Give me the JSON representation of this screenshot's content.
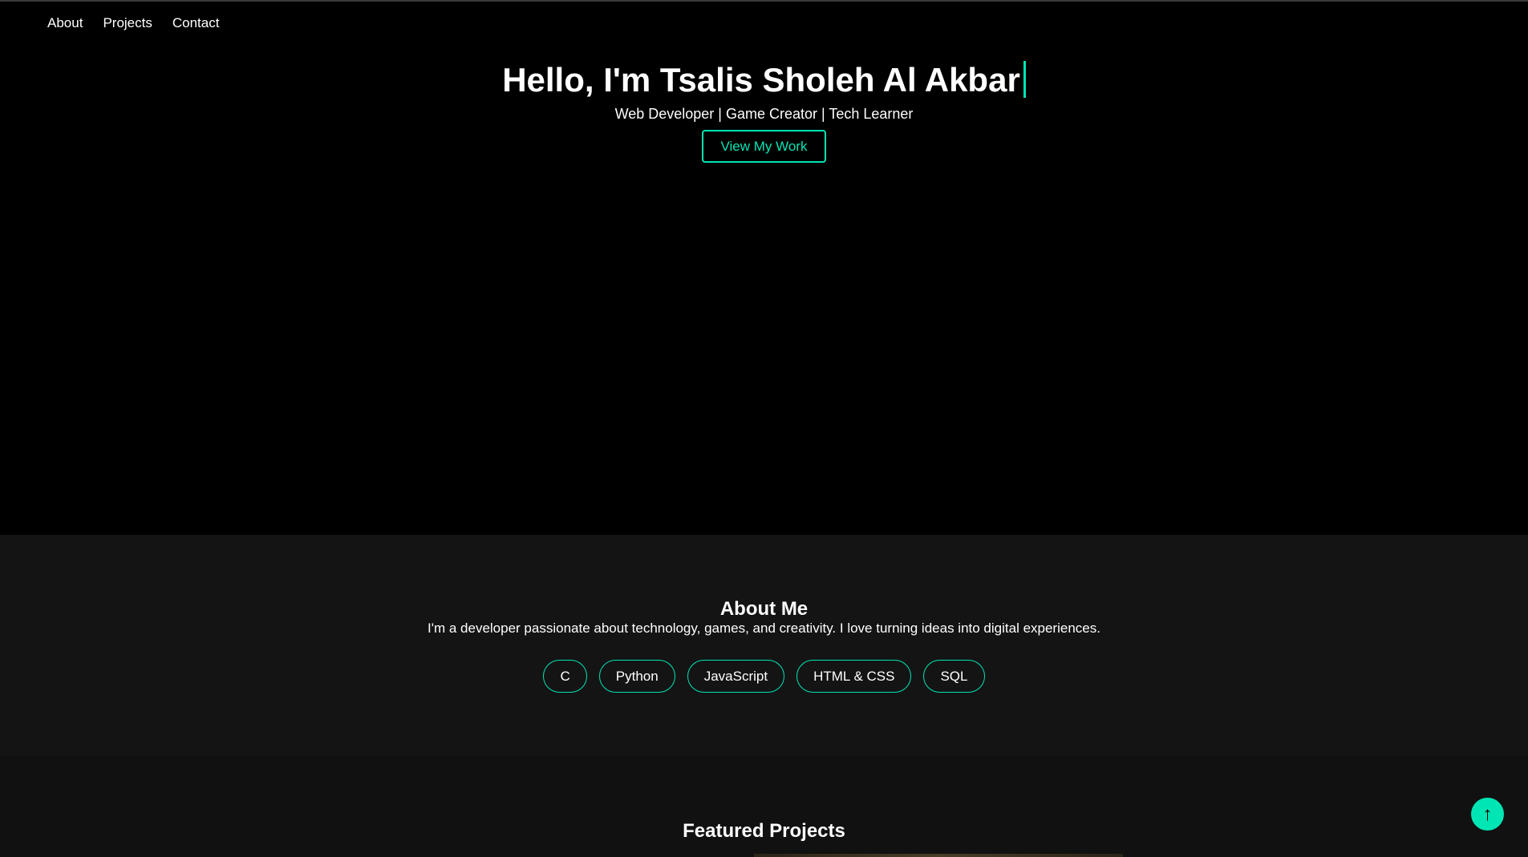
{
  "nav": {
    "items": [
      {
        "label": "About"
      },
      {
        "label": "Projects"
      },
      {
        "label": "Contact"
      }
    ]
  },
  "hero": {
    "title": "Hello, I'm Tsalis Sholeh Al Akbar",
    "subtitle": "Web Developer | Game Creator | Tech Learner",
    "button_label": "View My Work"
  },
  "about": {
    "title": "About Me",
    "text": "I'm a developer passionate about technology, games, and creativity. I love turning ideas into digital experiences.",
    "skills": [
      "C",
      "Python",
      "JavaScript",
      "HTML & CSS",
      "SQL"
    ]
  },
  "projects": {
    "title": "Featured Projects"
  },
  "scroll_top": {
    "icon": "↑"
  },
  "colors": {
    "accent": "#00e5b4",
    "hero_bg": "#000000",
    "about_bg": "#141414",
    "projects_bg": "#111111"
  }
}
